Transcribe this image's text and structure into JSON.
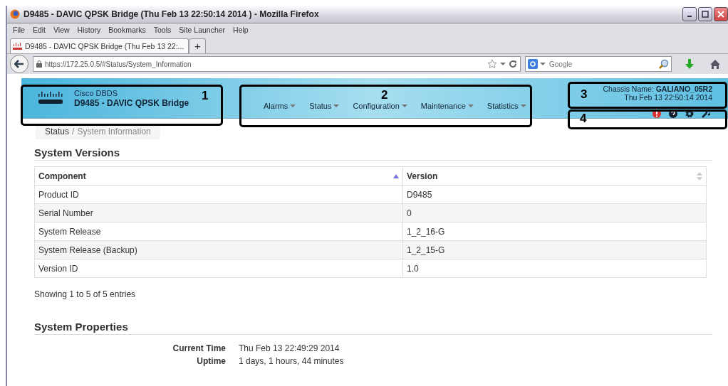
{
  "window": {
    "title": "D9485 - DAVIC QPSK Bridge (Thu Feb 13 22:50:14 2014 ) - Mozilla Firefox"
  },
  "menu": [
    "File",
    "Edit",
    "View",
    "History",
    "Bookmarks",
    "Tools",
    "Site Launcher",
    "Help"
  ],
  "tabs": [
    {
      "label": "D9485 - DAVIC QPSK Bridge (Thu Feb 13 22:...",
      "selected": true
    }
  ],
  "new_tab": "+",
  "address": "https://172.25.0.5/#Status/System_Information",
  "search": {
    "placeholder": "Google"
  },
  "header": {
    "brand": "Cisco DBDS",
    "product": "D9485 - DAVIC QPSK Bridge",
    "chassis_label": "Chassis Name:",
    "chassis_name": "GALIANO_05R2",
    "datetime": "Thu Feb 13 22:50:14 2014"
  },
  "nav": [
    "Alarms",
    "Status",
    "Configuration",
    "Maintenance",
    "Statistics"
  ],
  "breadcrumb": [
    "Status",
    "/",
    "System Information"
  ],
  "versions": {
    "title": "System Versions",
    "columns": [
      {
        "label": "Component",
        "sorted": true
      },
      {
        "label": "Version",
        "sorted": false
      }
    ],
    "rows": [
      [
        "Product ID",
        "D9485"
      ],
      [
        "Serial Number",
        "0"
      ],
      [
        "System Release",
        "1_2_16-G"
      ],
      [
        "System Release (Backup)",
        "1_2_15-G"
      ],
      [
        "Version ID",
        "1.0"
      ]
    ],
    "footer": "Showing 1 to 5 of 5 entries"
  },
  "properties": {
    "title": "System Properties",
    "items": [
      {
        "label": "Current Time",
        "value": "Thu Feb 13 22:49:29 2014"
      },
      {
        "label": "Uptime",
        "value": "1 days, 1 hours, 44 minutes"
      }
    ]
  },
  "annotations": [
    "1",
    "2",
    "3",
    "4"
  ]
}
